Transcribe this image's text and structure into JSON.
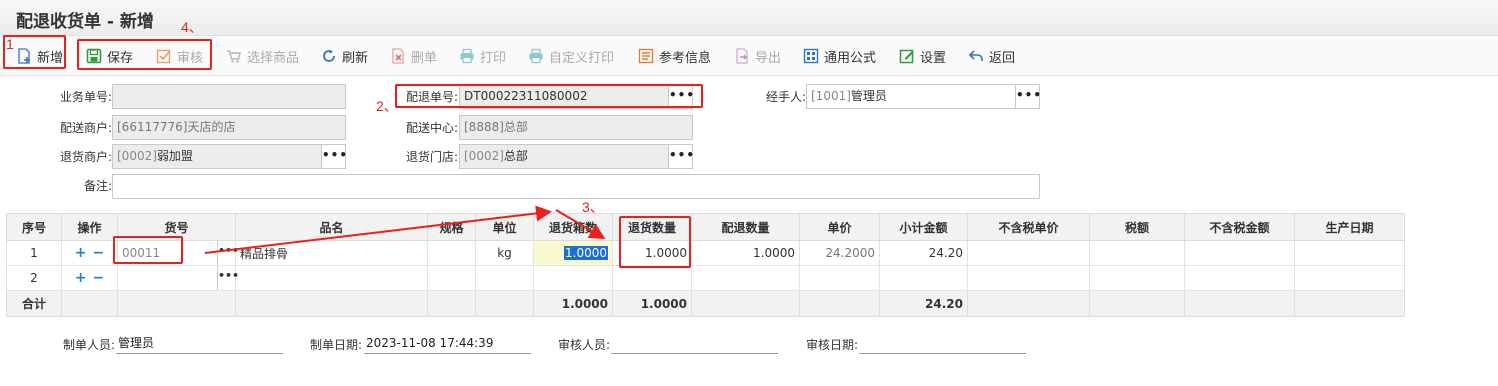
{
  "title": "配退收货单 - 新增",
  "toolbar": {
    "new": "新增",
    "save": "保存",
    "audit": "审核",
    "select_goods": "选择商品",
    "refresh": "刷新",
    "delete": "删单",
    "print": "打印",
    "custom_print": "自定义打印",
    "reference": "参考信息",
    "export": "导出",
    "formula": "通用公式",
    "settings": "设置",
    "back": "返回"
  },
  "annotations": [
    "1",
    "4、",
    "2、",
    "3、"
  ],
  "form": {
    "biz_no_label": "业务单号:",
    "biz_no_value": "",
    "return_no_label": "配退单号:",
    "return_no_value": "DT00022311080002",
    "handler_label": "经手人:",
    "handler_code": "[1001]",
    "handler_name": "管理员",
    "dist_merchant_label": "配送商户:",
    "dist_merchant_value": "[66117776]天店的店",
    "dist_center_label": "配送中心:",
    "dist_center_value": "[8888]总部",
    "return_merchant_label": "退货商户:",
    "return_merchant_code": "[0002]",
    "return_merchant_name": "弱加盟",
    "return_store_label": "退货门店:",
    "return_store_code": "[0002]",
    "return_store_name": "总部",
    "remark_label": "备注:",
    "remark_value": "",
    "dots": "•••"
  },
  "table": {
    "headers": [
      "序号",
      "操作",
      "货号",
      "品名",
      "规格",
      "单位",
      "退货箱数",
      "退货数量",
      "配退数量",
      "单价",
      "小计金额",
      "不含税单价",
      "税额",
      "不含税金额",
      "生产日期"
    ],
    "rows": [
      {
        "seq": "1",
        "plus": "+",
        "minus": "−",
        "code": "00011",
        "name": "精品排骨",
        "spec": "",
        "unit": "kg",
        "boxes": "1.0000",
        "qty": "1.0000",
        "dist_qty": "1.0000",
        "price": "24.2000",
        "subtotal": "24.20",
        "price_ex_tax": "",
        "tax": "",
        "amount_ex_tax": "",
        "prod_date": ""
      },
      {
        "seq": "2",
        "plus": "+",
        "minus": "−",
        "code": "",
        "name": "",
        "spec": "",
        "unit": "",
        "boxes": "",
        "qty": "",
        "dist_qty": "",
        "price": "",
        "subtotal": "",
        "price_ex_tax": "",
        "tax": "",
        "amount_ex_tax": "",
        "prod_date": ""
      }
    ],
    "total": {
      "label": "合计",
      "boxes": "1.0000",
      "qty": "1.0000",
      "subtotal": "24.20"
    },
    "dots": "•••"
  },
  "footer": {
    "maker_label": "制单人员:",
    "maker_value": "管理员",
    "make_date_label": "制单日期:",
    "make_date_value": "2023-11-08 17:44:39",
    "auditor_label": "审核人员:",
    "auditor_value": "",
    "audit_date_label": "审核日期:",
    "audit_date_value": ""
  },
  "colors": {
    "annotation_red": "#e8211c",
    "selection_blue": "#1e6ed8",
    "accent_blue": "#1a7fd4",
    "input_grey": "#ececec"
  }
}
